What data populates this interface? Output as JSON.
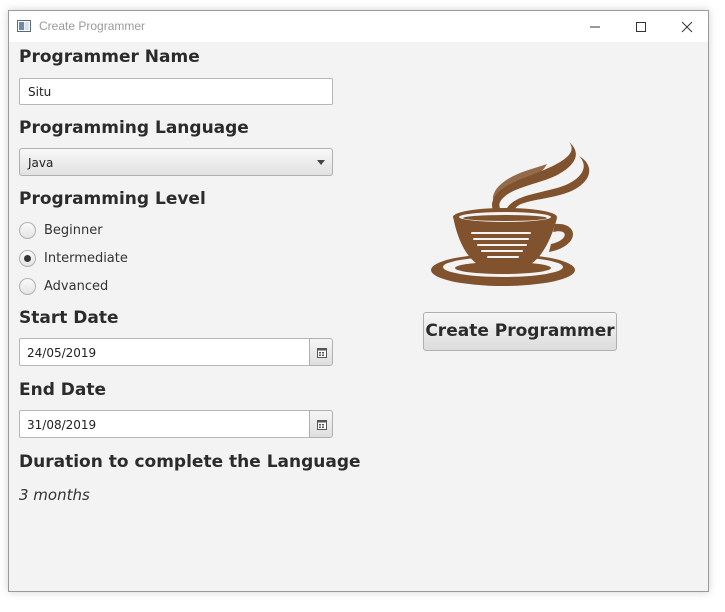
{
  "window": {
    "title": "Create Programmer"
  },
  "form": {
    "name_label": "Programmer Name",
    "name_value": "Situ",
    "language_label": "Programming Language",
    "language_selected": "Java",
    "level_label": "Programming Level",
    "levels": [
      {
        "label": "Beginner",
        "selected": false
      },
      {
        "label": "Intermediate",
        "selected": true
      },
      {
        "label": "Advanced",
        "selected": false
      }
    ],
    "start_label": "Start Date",
    "start_value": "24/05/2019",
    "end_label": "End Date",
    "end_value": "31/08/2019",
    "duration_label": "Duration to complete the Language",
    "duration_value": "3 months"
  },
  "actions": {
    "create_label": "Create Programmer"
  },
  "colors": {
    "logo_brown": "#80522e",
    "window_bg": "#f3f3f3"
  },
  "icons": {
    "app": "app-window-icon",
    "minimize": "minimize-icon",
    "maximize": "maximize-icon",
    "close": "close-icon",
    "calendar": "calendar-icon",
    "logo": "coffee-cup-icon"
  }
}
